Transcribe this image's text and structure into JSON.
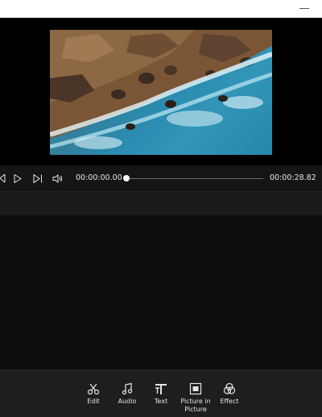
{
  "player": {
    "current_time": "00:00:00.00",
    "total_time": "00:00:28.82",
    "progress_fraction": 0.0
  },
  "toolbar": {
    "items": [
      {
        "label": "Edit",
        "icon": "scissors-icon"
      },
      {
        "label": "Audio",
        "icon": "music-note-icon"
      },
      {
        "label": "Text",
        "icon": "text-icon"
      },
      {
        "label": "Picture in Picture",
        "icon": "picture-in-picture-icon"
      },
      {
        "label": "Effect",
        "icon": "effect-circles-icon"
      }
    ]
  },
  "colors": {
    "background": "#0d0d0d",
    "toolbar_background": "#1e1e1e",
    "text": "#e6e6e6"
  }
}
